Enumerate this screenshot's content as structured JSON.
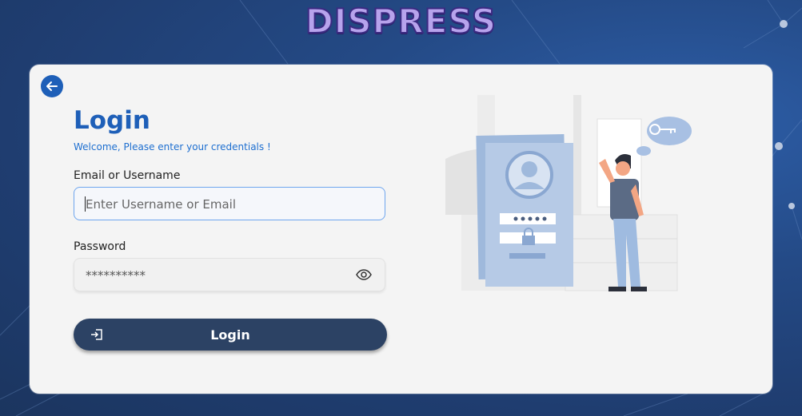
{
  "brand": {
    "name": "DISPRESS"
  },
  "login_form": {
    "title": "Login",
    "subtitle": "Welcome, Please enter your credentials !",
    "email_label": "Email or Username",
    "email_placeholder": "Enter Username or Email",
    "email_value": "",
    "password_label": "Password",
    "password_value": "**********",
    "submit_label": "Login"
  },
  "icons": {
    "back": "arrow-left-icon",
    "toggle_password": "eye-icon",
    "submit": "sign-in-icon"
  },
  "colors": {
    "primary": "#1e5fb8",
    "button": "#2c4264",
    "card": "#f4f4f4",
    "background": "#244a86"
  }
}
